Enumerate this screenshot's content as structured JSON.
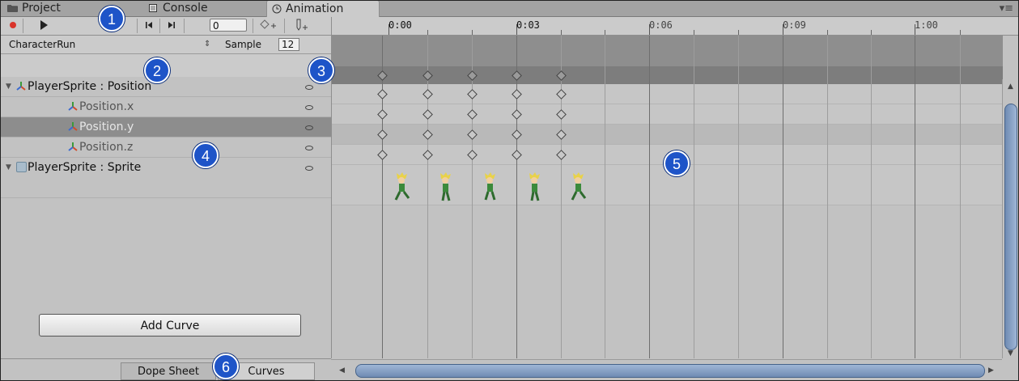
{
  "tabs": [
    {
      "label": "Project",
      "icon": "folder-icon",
      "active": false
    },
    {
      "label": "Console",
      "icon": "console-icon",
      "active": false
    },
    {
      "label": "Animation",
      "icon": "clock-icon",
      "active": true
    }
  ],
  "window_menu_icon": "menu-icon",
  "toolbar": {
    "record_icon": "record-icon",
    "play_icon": "play-icon",
    "prev_key_icon": "prev-keyframe-icon",
    "next_key_icon": "next-keyframe-icon",
    "frame_value": "0",
    "add_keyframe_icon": "add-keyframe-icon",
    "add_event_icon": "add-event-icon"
  },
  "ruler": {
    "labels": [
      "0:00",
      "0:03",
      "0:06",
      "0:09",
      "1:00"
    ]
  },
  "clip": {
    "name": "CharacterRun",
    "sample_label": "Sample",
    "sample_value": "12"
  },
  "properties": [
    {
      "label": "PlayerSprite : Position",
      "type": "group",
      "icon": "transform-icon"
    },
    {
      "label": "Position.x",
      "type": "sub",
      "icon": "transform-icon"
    },
    {
      "label": "Position.y",
      "type": "sub",
      "icon": "transform-icon",
      "selected": true
    },
    {
      "label": "Position.z",
      "type": "sub",
      "icon": "transform-icon"
    },
    {
      "label": "PlayerSprite : Sprite",
      "type": "group",
      "icon": "sprite-renderer-icon"
    }
  ],
  "add_curve_label": "Add Curve",
  "bottom_tabs": {
    "dope_sheet": "Dope Sheet",
    "curves": "Curves"
  },
  "keyframe_count": 5,
  "callouts": [
    "1",
    "2",
    "3",
    "4",
    "5",
    "6"
  ],
  "colors": {
    "selection": "#8d8d8d",
    "callout": "#1e54c8",
    "scrollbar": "#7f9bc3",
    "record": "#d9342b"
  }
}
